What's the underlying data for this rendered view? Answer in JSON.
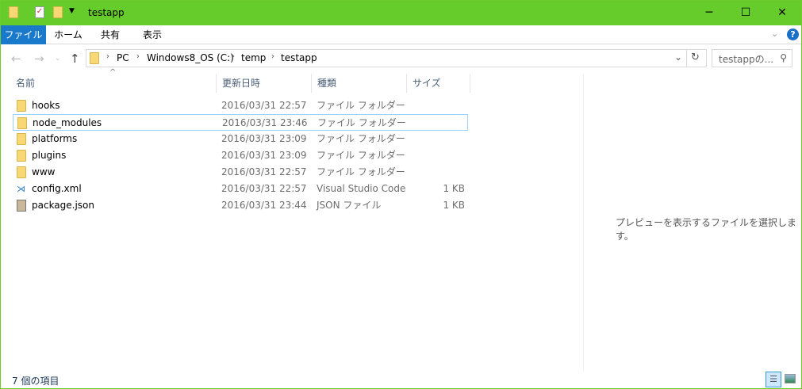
{
  "window": {
    "title": "testapp",
    "controls": {
      "minimize": "─",
      "maximize": "☐",
      "close": "✕"
    }
  },
  "ribbon": {
    "tabs": [
      "ファイル",
      "ホーム",
      "共有",
      "表示"
    ],
    "help": "?"
  },
  "address": {
    "crumbs": [
      "PC",
      "Windows8_OS (C:)",
      "temp",
      "testapp"
    ]
  },
  "search": {
    "placeholder": "testappの..."
  },
  "columns": [
    "名前",
    "更新日時",
    "種類",
    "サイズ"
  ],
  "files": [
    {
      "name": "hooks",
      "date": "2016/03/31 22:57",
      "type": "ファイル フォルダー",
      "size": "",
      "icon": "folder"
    },
    {
      "name": "node_modules",
      "date": "2016/03/31 23:46",
      "type": "ファイル フォルダー",
      "size": "",
      "icon": "folder"
    },
    {
      "name": "platforms",
      "date": "2016/03/31 23:09",
      "type": "ファイル フォルダー",
      "size": "",
      "icon": "folder"
    },
    {
      "name": "plugins",
      "date": "2016/03/31 23:09",
      "type": "ファイル フォルダー",
      "size": "",
      "icon": "folder"
    },
    {
      "name": "www",
      "date": "2016/03/31 22:57",
      "type": "ファイル フォルダー",
      "size": "",
      "icon": "folder"
    },
    {
      "name": "config.xml",
      "date": "2016/03/31 22:57",
      "type": "Visual Studio Code",
      "size": "1 KB",
      "icon": "vscode"
    },
    {
      "name": "package.json",
      "date": "2016/03/31 23:44",
      "type": "JSON ファイル",
      "size": "1 KB",
      "icon": "json"
    }
  ],
  "preview": {
    "message": "プレビューを表示するファイルを選択します。"
  },
  "status": {
    "count": "7 個の項目"
  }
}
